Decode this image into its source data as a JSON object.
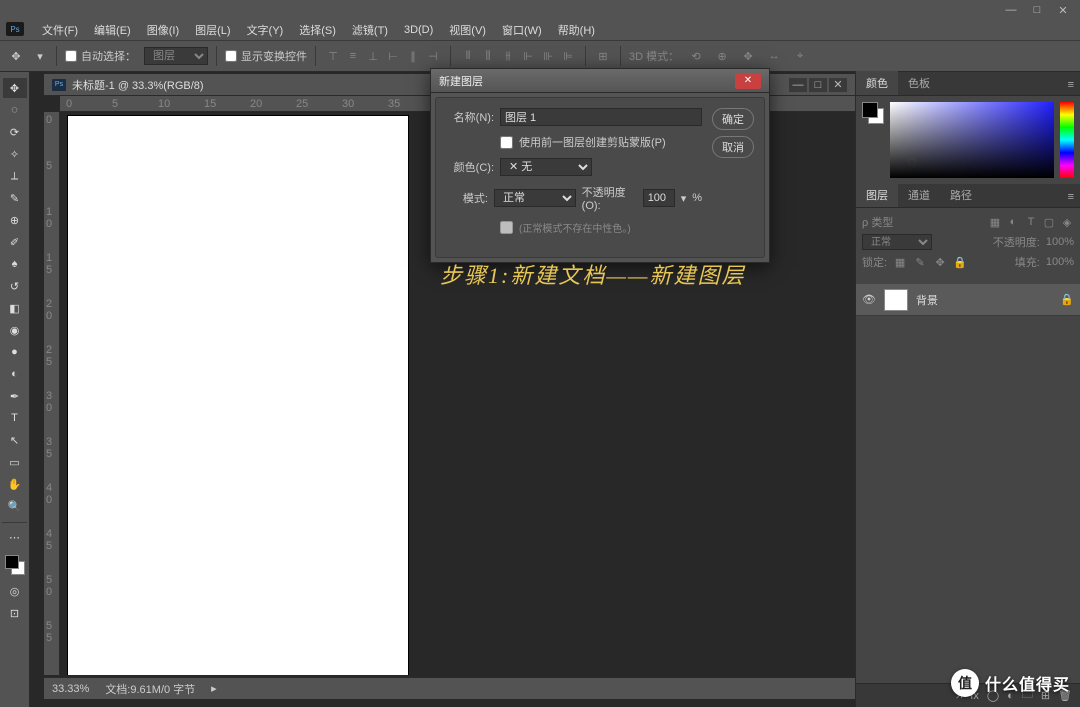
{
  "window": {
    "minimize": "—",
    "maximize": "□",
    "close": "✕"
  },
  "menu": [
    "文件(F)",
    "编辑(E)",
    "图像(I)",
    "图层(L)",
    "文字(Y)",
    "选择(S)",
    "滤镜(T)",
    "3D(D)",
    "视图(V)",
    "窗口(W)",
    "帮助(H)"
  ],
  "logo": "Ps",
  "options": {
    "auto_select": "自动选择：",
    "auto_select_target": "图层",
    "show_transform": "显示变换控件",
    "mode3d": "3D 模式："
  },
  "doc": {
    "title": "未标题-1 @ 33.3%(RGB/8)",
    "zoom": "33.33%",
    "status": "文档:9.61M/0 字节"
  },
  "ruler_h": [
    "0",
    "5",
    "10",
    "15",
    "20",
    "25",
    "30",
    "35"
  ],
  "ruler_v": [
    "0",
    "5",
    "1 0",
    "1 5",
    "2 0",
    "2 5",
    "3 0",
    "3 5",
    "4 0",
    "4 5",
    "5 0",
    "5 5"
  ],
  "dialog": {
    "title": "新建图层",
    "name_label": "名称(N):",
    "name_value": "图层 1",
    "clip_label": "使用前一图层创建剪贴蒙版(P)",
    "color_label": "颜色(C):",
    "color_value": "✕ 无",
    "mode_label": "模式:",
    "mode_value": "正常",
    "opacity_label": "不透明度(O):",
    "opacity_value": "100",
    "opacity_unit": "%",
    "note": "(正常模式不存在中性色。)",
    "ok": "确定",
    "cancel": "取消"
  },
  "annotation": "步骤1:新建文档——新建图层",
  "panels": {
    "color_tab": "颜色",
    "swatch_tab": "色板",
    "layers_tab": "图层",
    "channels_tab": "通道",
    "paths_tab": "路径",
    "kind_label": "ρ 类型",
    "blend_mode": "正常",
    "opacity_label": "不透明度:",
    "opacity_value": "100%",
    "lock_label": "锁定:",
    "fill_label": "填充:",
    "fill_value": "100%",
    "layer1": "背景"
  },
  "watermark": {
    "badge": "值",
    "text": "什么值得买"
  }
}
